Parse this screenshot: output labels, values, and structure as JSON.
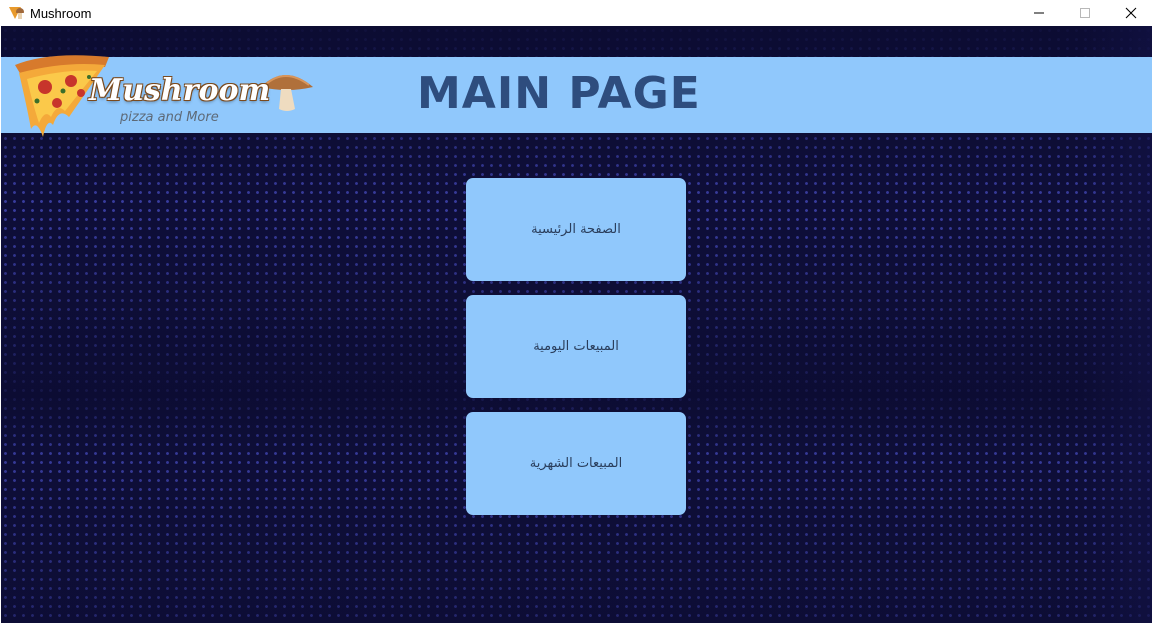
{
  "window": {
    "title": "Mushroom",
    "controls": {
      "minimize_icon": "minimize-icon",
      "maximize_icon": "maximize-icon",
      "close_icon": "close-icon"
    }
  },
  "header": {
    "logo_text": "Mushroom",
    "logo_tagline": "pizza and More",
    "page_title": "MAIN PAGE"
  },
  "menu": {
    "items": [
      {
        "label": "الصفحة الرئيسية"
      },
      {
        "label": "المبيعات اليومية"
      },
      {
        "label": "المبيعات الشهرية"
      }
    ]
  },
  "colors": {
    "header_background": "#90c8fc",
    "button_background": "#90c8fc",
    "title_color": "#2e4d7e",
    "page_background": "#0f0f3a",
    "dot_color": "#4e54d2"
  }
}
